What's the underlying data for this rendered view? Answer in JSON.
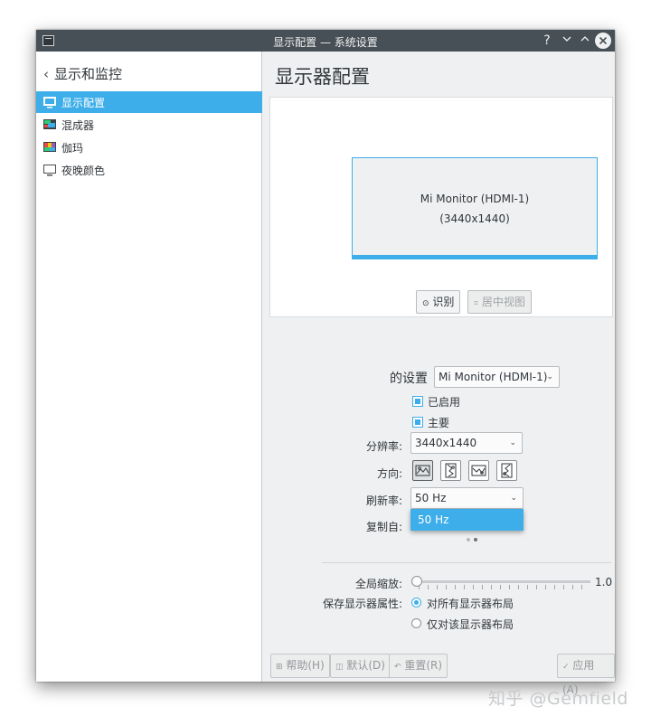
{
  "window": {
    "title": "显示配置 — 系统设置",
    "help_glyph": "?",
    "minimize_glyph": "﹀",
    "maximize_glyph": "︿",
    "close_glyph": "✕"
  },
  "sidebar": {
    "back_label": "显示和监控",
    "items": [
      {
        "label": "显示配置",
        "icon": "monitor-icon",
        "active": true
      },
      {
        "label": "混成器",
        "icon": "compositor-icon",
        "active": false
      },
      {
        "label": "伽玛",
        "icon": "gamma-icon",
        "active": false
      },
      {
        "label": "夜晚颜色",
        "icon": "night-color-icon",
        "active": false
      }
    ]
  },
  "main": {
    "title": "显示器配置",
    "preview": {
      "monitor_name": "Mi Monitor (HDMI-1)",
      "monitor_resolution": "(3440x1440)",
      "identify_label": "识别",
      "center_view_label": "居中视图"
    },
    "output": {
      "settings_label": "的设置",
      "output_selected": "Mi Monitor (HDMI-1)",
      "enabled_label": "已启用",
      "enabled_checked": true,
      "primary_label": "主要",
      "primary_checked": true,
      "resolution_label": "分辨率:",
      "resolution_value": "3440x1440",
      "orientation_label": "方向:",
      "orientations": [
        "landscape-icon",
        "portrait-left-icon",
        "inverted-icon",
        "portrait-right-icon"
      ],
      "refresh_label": "刷新率:",
      "refresh_value": "50 Hz",
      "refresh_options": [
        "50 Hz"
      ],
      "replica_label": "复制自:"
    },
    "global": {
      "scale_label": "全局缩放:",
      "scale_value": "1.0",
      "scale_fraction": 0.0,
      "save_label": "保存显示器属性:",
      "save_options": [
        {
          "label": "对所有显示器布局",
          "checked": true
        },
        {
          "label": "仅对该显示器布局",
          "checked": false
        }
      ]
    }
  },
  "footer": {
    "help": "帮助(H)",
    "defaults": "默认(D)",
    "reset": "重置(R)",
    "apply": "应用(A)"
  },
  "watermark": "知乎 @Gemfield",
  "colors": {
    "accent": "#3daee9",
    "titlebar": "#475057",
    "window_bg": "#eff0f1"
  }
}
